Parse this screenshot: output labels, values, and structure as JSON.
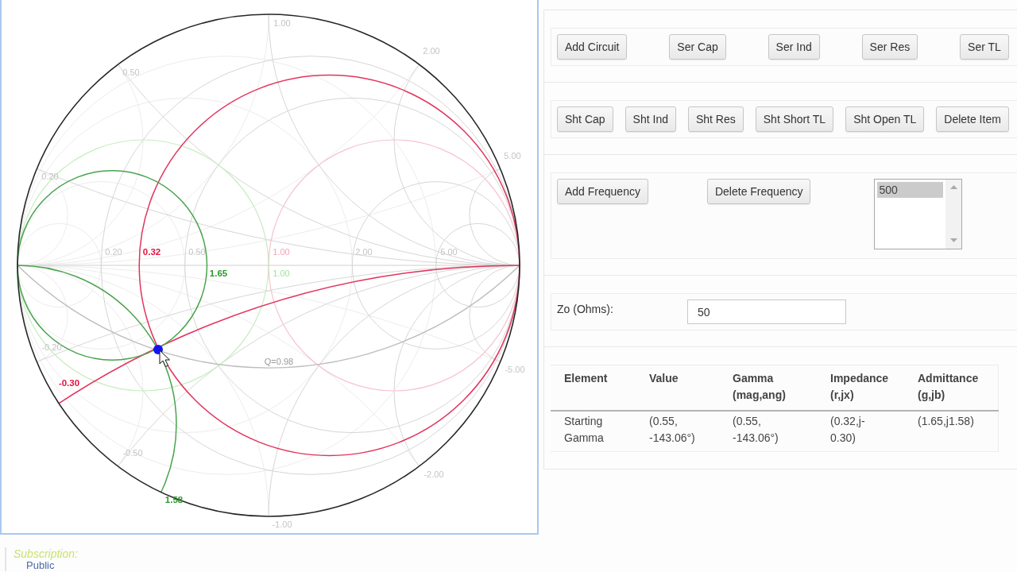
{
  "smith_chart": {
    "labels": [
      {
        "text": "1.00",
        "kind": "grid",
        "color": "#c4c4c4"
      },
      {
        "text": "2.00",
        "kind": "grid",
        "color": "#c4c4c4"
      },
      {
        "text": "0.50",
        "kind": "grid",
        "color": "#c4c4c4"
      },
      {
        "text": "5.00",
        "kind": "grid",
        "color": "#c4c4c4"
      },
      {
        "text": "0.20",
        "kind": "grid",
        "color": "#c4c4c4"
      },
      {
        "text": "0.20",
        "kind": "grid",
        "color": "#c4c4c4"
      },
      {
        "text": "0.32",
        "kind": "curve",
        "color": "#e3123f"
      },
      {
        "text": "0.50",
        "kind": "grid",
        "color": "#c4c4c4"
      },
      {
        "text": "1.00",
        "kind": "grid",
        "color": "#f2a3b6"
      },
      {
        "text": "2.00",
        "kind": "grid",
        "color": "#c4c4c4"
      },
      {
        "text": "5.00",
        "kind": "grid",
        "color": "#c4c4c4"
      },
      {
        "text": "1.65",
        "kind": "curve",
        "color": "#2a9a2e"
      },
      {
        "text": "1.00",
        "kind": "grid",
        "color": "#9ee596"
      },
      {
        "text": "-0.20",
        "kind": "grid",
        "color": "#c4c4c4"
      },
      {
        "text": "Q=0.98",
        "kind": "grid",
        "color": "#9a9a9a"
      },
      {
        "text": "-5.00",
        "kind": "grid",
        "color": "#c4c4c4"
      },
      {
        "text": "-0.30",
        "kind": "curve",
        "color": "#e3123f"
      },
      {
        "text": "-0.50",
        "kind": "grid",
        "color": "#c4c4c4"
      },
      {
        "text": "-2.00",
        "kind": "grid",
        "color": "#c4c4c4"
      },
      {
        "text": "1.58",
        "kind": "curve",
        "color": "#2a9a2e"
      },
      {
        "text": "-1.00",
        "kind": "grid",
        "color": "#c4c4c4"
      }
    ]
  },
  "series_buttons": [
    "Add Circuit",
    "Ser Cap",
    "Ser Ind",
    "Ser Res",
    "Ser TL"
  ],
  "shunt_buttons": [
    "Sht Cap",
    "Sht Ind",
    "Sht Res",
    "Sht Short TL",
    "Sht Open TL",
    "Delete Item"
  ],
  "frequency": {
    "buttons": [
      "Add Frequency",
      "Delete Frequency"
    ],
    "list": [
      {
        "label": "500",
        "selected": true
      }
    ]
  },
  "characteristic_impedance": {
    "label": "Zo (Ohms):",
    "value": "50"
  },
  "table": {
    "columns": [
      {
        "title": "Element"
      },
      {
        "title": "Value"
      },
      {
        "title": "Gamma",
        "unit": "(mag,ang)"
      },
      {
        "title": "Impedance",
        "unit": "(r,jx)"
      },
      {
        "title": "Admittance",
        "unit": "(g,jb)"
      }
    ],
    "rows": [
      {
        "cells": [
          "Starting Gamma",
          "(0.55, -143.06°)",
          "(0.55, -143.06°)",
          "(0.32,j-0.30)",
          "(1.65,j1.58)"
        ]
      }
    ]
  },
  "footer": {
    "title": "Subscription:",
    "item": "Public"
  }
}
